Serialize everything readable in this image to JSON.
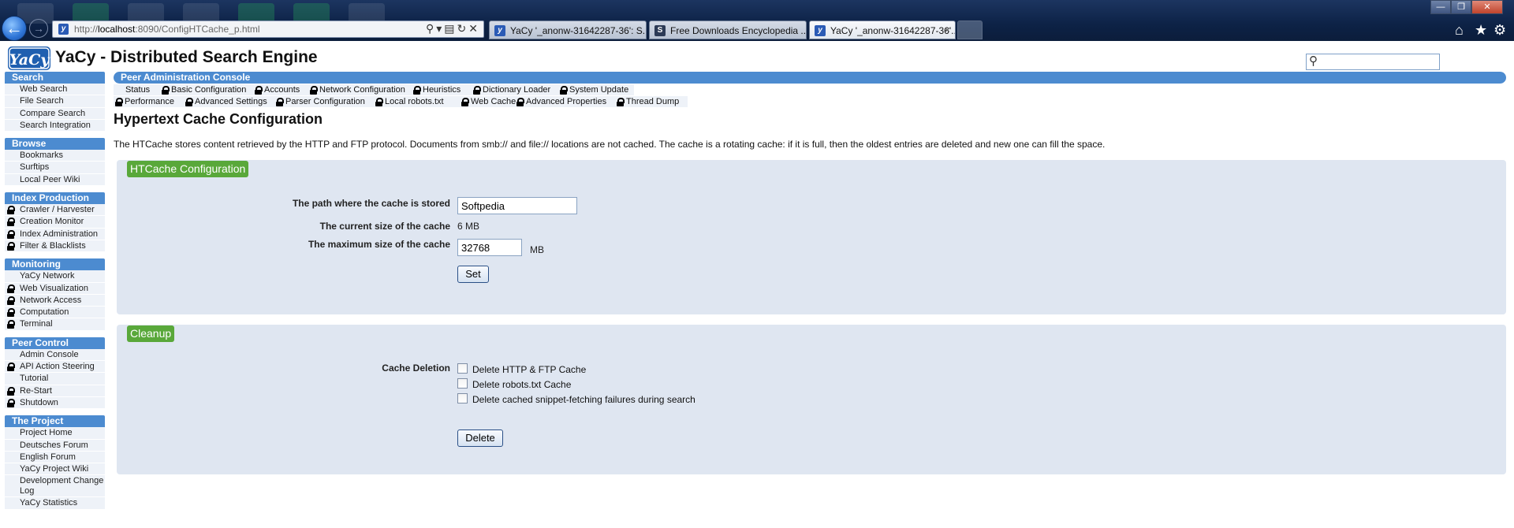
{
  "browser": {
    "url_prefix": "http://",
    "url_host": "localhost",
    "url_rest": ":8090/ConfigHTCache_p.html",
    "tabs": [
      {
        "label": "YaCy '_anonw-31642287-36': S...",
        "active": false
      },
      {
        "label": "Free Downloads Encyclopedia ...",
        "active": false
      },
      {
        "label": "YaCy '_anonw-31642287-36'...",
        "active": true
      }
    ],
    "tab_close": "×"
  },
  "site": {
    "logo_text": "YaCy",
    "title": "YaCy - Distributed Search Engine",
    "search_placeholder": ""
  },
  "sidebar": [
    {
      "title": "Search",
      "items": [
        {
          "label": "Web Search",
          "locked": false
        },
        {
          "label": "File Search",
          "locked": false
        },
        {
          "label": "Compare Search",
          "locked": false
        },
        {
          "label": "Search Integration",
          "locked": false
        }
      ]
    },
    {
      "title": "Browse",
      "items": [
        {
          "label": "Bookmarks",
          "locked": false
        },
        {
          "label": "Surftips",
          "locked": false
        },
        {
          "label": "Local Peer Wiki",
          "locked": false
        }
      ]
    },
    {
      "title": "Index Production",
      "items": [
        {
          "label": "Crawler / Harvester",
          "locked": true
        },
        {
          "label": "Creation Monitor",
          "locked": true
        },
        {
          "label": "Index Administration",
          "locked": true
        },
        {
          "label": "Filter & Blacklists",
          "locked": true
        }
      ]
    },
    {
      "title": "Monitoring",
      "items": [
        {
          "label": "YaCy Network",
          "locked": false
        },
        {
          "label": "Web Visualization",
          "locked": true
        },
        {
          "label": "Network Access",
          "locked": true
        },
        {
          "label": "Computation",
          "locked": true
        },
        {
          "label": "Terminal",
          "locked": true
        }
      ]
    },
    {
      "title": "Peer Control",
      "items": [
        {
          "label": "Admin Console",
          "locked": false
        },
        {
          "label": "API Action Steering",
          "locked": true
        },
        {
          "label": "Tutorial",
          "locked": false
        },
        {
          "label": "Re-Start",
          "locked": true
        },
        {
          "label": "Shutdown",
          "locked": true
        }
      ]
    },
    {
      "title": "The Project",
      "items": [
        {
          "label": "Project Home",
          "locked": false
        },
        {
          "label": "Deutsches Forum",
          "locked": false
        },
        {
          "label": "English Forum",
          "locked": false
        },
        {
          "label": "YaCy Project Wiki",
          "locked": false
        },
        {
          "label": "Development Change Log",
          "locked": false
        },
        {
          "label": "YaCy Statistics",
          "locked": false
        }
      ]
    }
  ],
  "main": {
    "console_title": "Peer Administration Console",
    "nav_row1": [
      {
        "label": "Status",
        "locked": false
      },
      {
        "label": "Basic Configuration",
        "locked": true
      },
      {
        "label": "Accounts",
        "locked": true
      },
      {
        "label": "Network Configuration",
        "locked": true
      },
      {
        "label": "Heuristics",
        "locked": true
      },
      {
        "label": "Dictionary Loader",
        "locked": true
      },
      {
        "label": "System Update",
        "locked": true
      }
    ],
    "nav_row2": [
      {
        "label": "Performance",
        "locked": true
      },
      {
        "label": "Advanced Settings",
        "locked": true
      },
      {
        "label": "Parser Configuration",
        "locked": true
      },
      {
        "label": "Local robots.txt",
        "locked": true
      },
      {
        "label": "Web Cache",
        "locked": true
      },
      {
        "label": "Advanced Properties",
        "locked": true
      },
      {
        "label": "Thread Dump",
        "locked": true
      }
    ],
    "heading": "Hypertext Cache Configuration",
    "intro": "The HTCache stores content retrieved by the HTTP and FTP protocol. Documents from smb:// and file:// locations are not cached. The cache is a rotating cache: if it is full, then the oldest entries are deleted and new one can fill the space."
  },
  "htcache": {
    "legend": "HTCache Configuration",
    "path_label": "The path where the cache is stored",
    "path_value": "Softpedia",
    "current_label": "The current size of the cache",
    "current_value": "6 MB",
    "max_label": "The maximum size of the cache",
    "max_value": "32768",
    "max_unit": "MB",
    "set_button": "Set"
  },
  "cleanup": {
    "legend": "Cleanup",
    "deletion_label": "Cache Deletion",
    "options": [
      {
        "label": "Delete HTTP & FTP Cache",
        "checked": false
      },
      {
        "label": "Delete robots.txt Cache",
        "checked": false
      },
      {
        "label": "Delete cached snippet-fetching failures during search",
        "checked": false
      }
    ],
    "delete_button": "Delete"
  }
}
